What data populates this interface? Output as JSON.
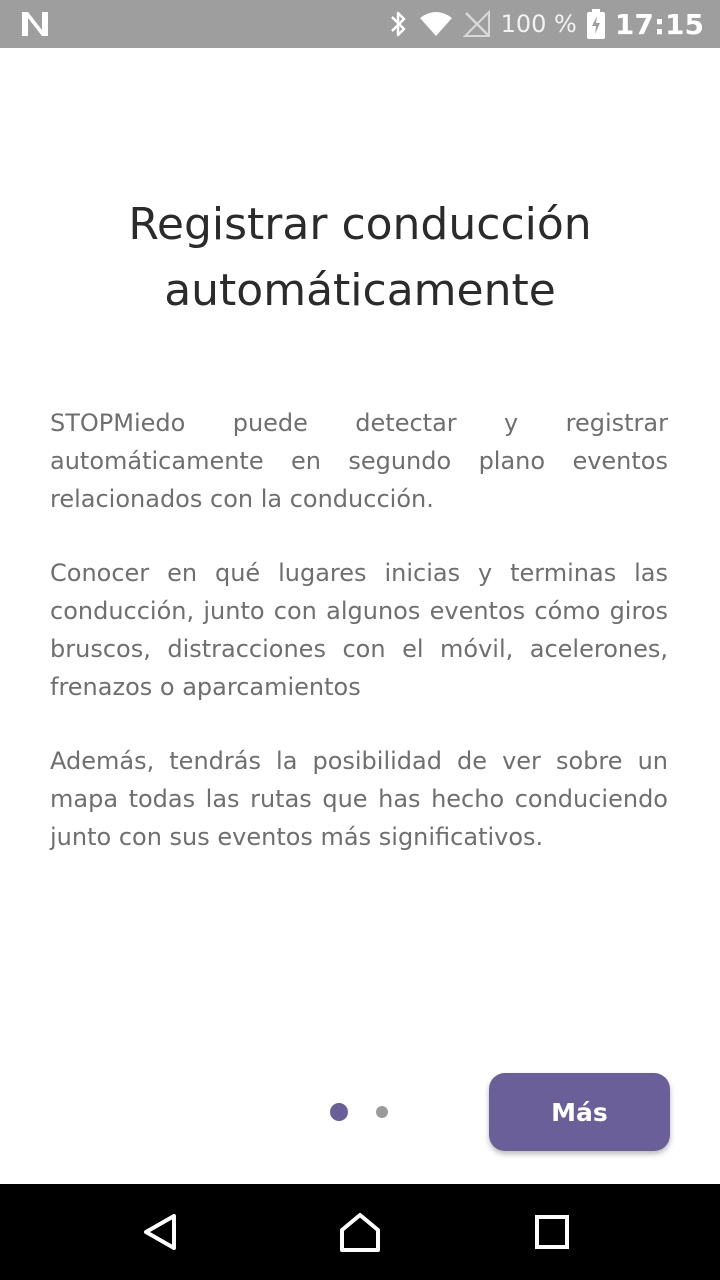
{
  "status_bar": {
    "notification_icon": "n-icon",
    "bluetooth_icon": "bluetooth-icon",
    "wifi_icon": "wifi-icon",
    "signal_icon": "no-signal-icon",
    "battery_percent": "100 %",
    "battery_icon": "battery-charging-icon",
    "time": "17:15"
  },
  "onboarding": {
    "title_line1": "Registrar conducción",
    "title_line2": "automáticamente",
    "paragraphs": [
      "STOPMiedo puede detectar y registrar automáticamente en segundo plano eventos relacionados con la conducción.",
      "Conocer en qué lugares inicias y terminas las conducción, junto con algunos eventos cómo giros bruscos, distracciones con el móvil, acelerones, frenazos o aparcamientos",
      "Además, tendrás la posibilidad de ver sobre un mapa todas las rutas que has hecho conduciendo junto con sus eventos más significativos."
    ],
    "pager": {
      "current_page": 1,
      "total_pages": 2
    },
    "more_button_label": "Más"
  },
  "nav_bar": {
    "back_icon": "back-triangle-icon",
    "home_icon": "home-icon",
    "recents_icon": "recents-square-icon"
  },
  "colors": {
    "accent": "#6b5f9a",
    "status_bar": "#9e9e9e",
    "title_text": "#2b2b2b",
    "body_text": "#6f6f6f",
    "nav_bar": "#000000"
  }
}
